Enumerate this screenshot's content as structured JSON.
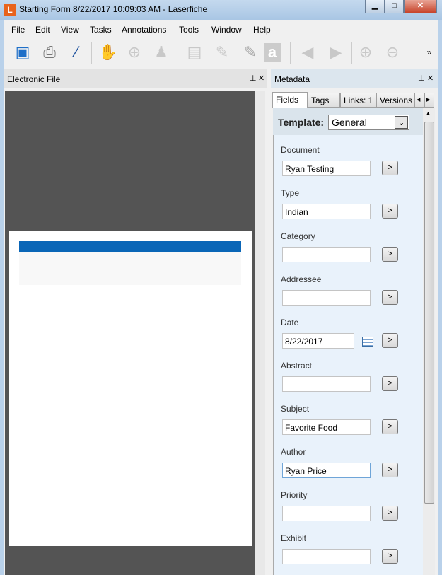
{
  "window": {
    "title": "Starting Form 8/22/2017 10:09:03 AM - Laserfiche",
    "app_icon_letter": "L",
    "minimize": "▁",
    "maximize": "□",
    "close": "✕"
  },
  "menu": [
    "File",
    "Edit",
    "View",
    "Tasks",
    "Annotations",
    "Tools",
    "Window",
    "Help"
  ],
  "toolbar": {
    "overflow": "»"
  },
  "left_panel": {
    "title": "Electronic File",
    "pin": "⊥",
    "close": "✕"
  },
  "right_panel": {
    "title": "Metadata",
    "pin": "⊥",
    "close": "✕"
  },
  "tabs": [
    "Fields",
    "Tags",
    "Links: 1",
    "Versions"
  ],
  "template": {
    "label": "Template:",
    "value": "General"
  },
  "fields": [
    {
      "label": "Document",
      "value": "Ryan Testing"
    },
    {
      "label": "Type",
      "value": "Indian"
    },
    {
      "label": "Category",
      "value": ""
    },
    {
      "label": "Addressee",
      "value": ""
    },
    {
      "label": "Date",
      "value": "8/22/2017"
    },
    {
      "label": "Abstract",
      "value": ""
    },
    {
      "label": "Subject",
      "value": "Favorite Food"
    },
    {
      "label": "Author",
      "value": "Ryan Price"
    },
    {
      "label": "Priority",
      "value": ""
    },
    {
      "label": "Exhibit",
      "value": ""
    }
  ],
  "field_button": ">"
}
